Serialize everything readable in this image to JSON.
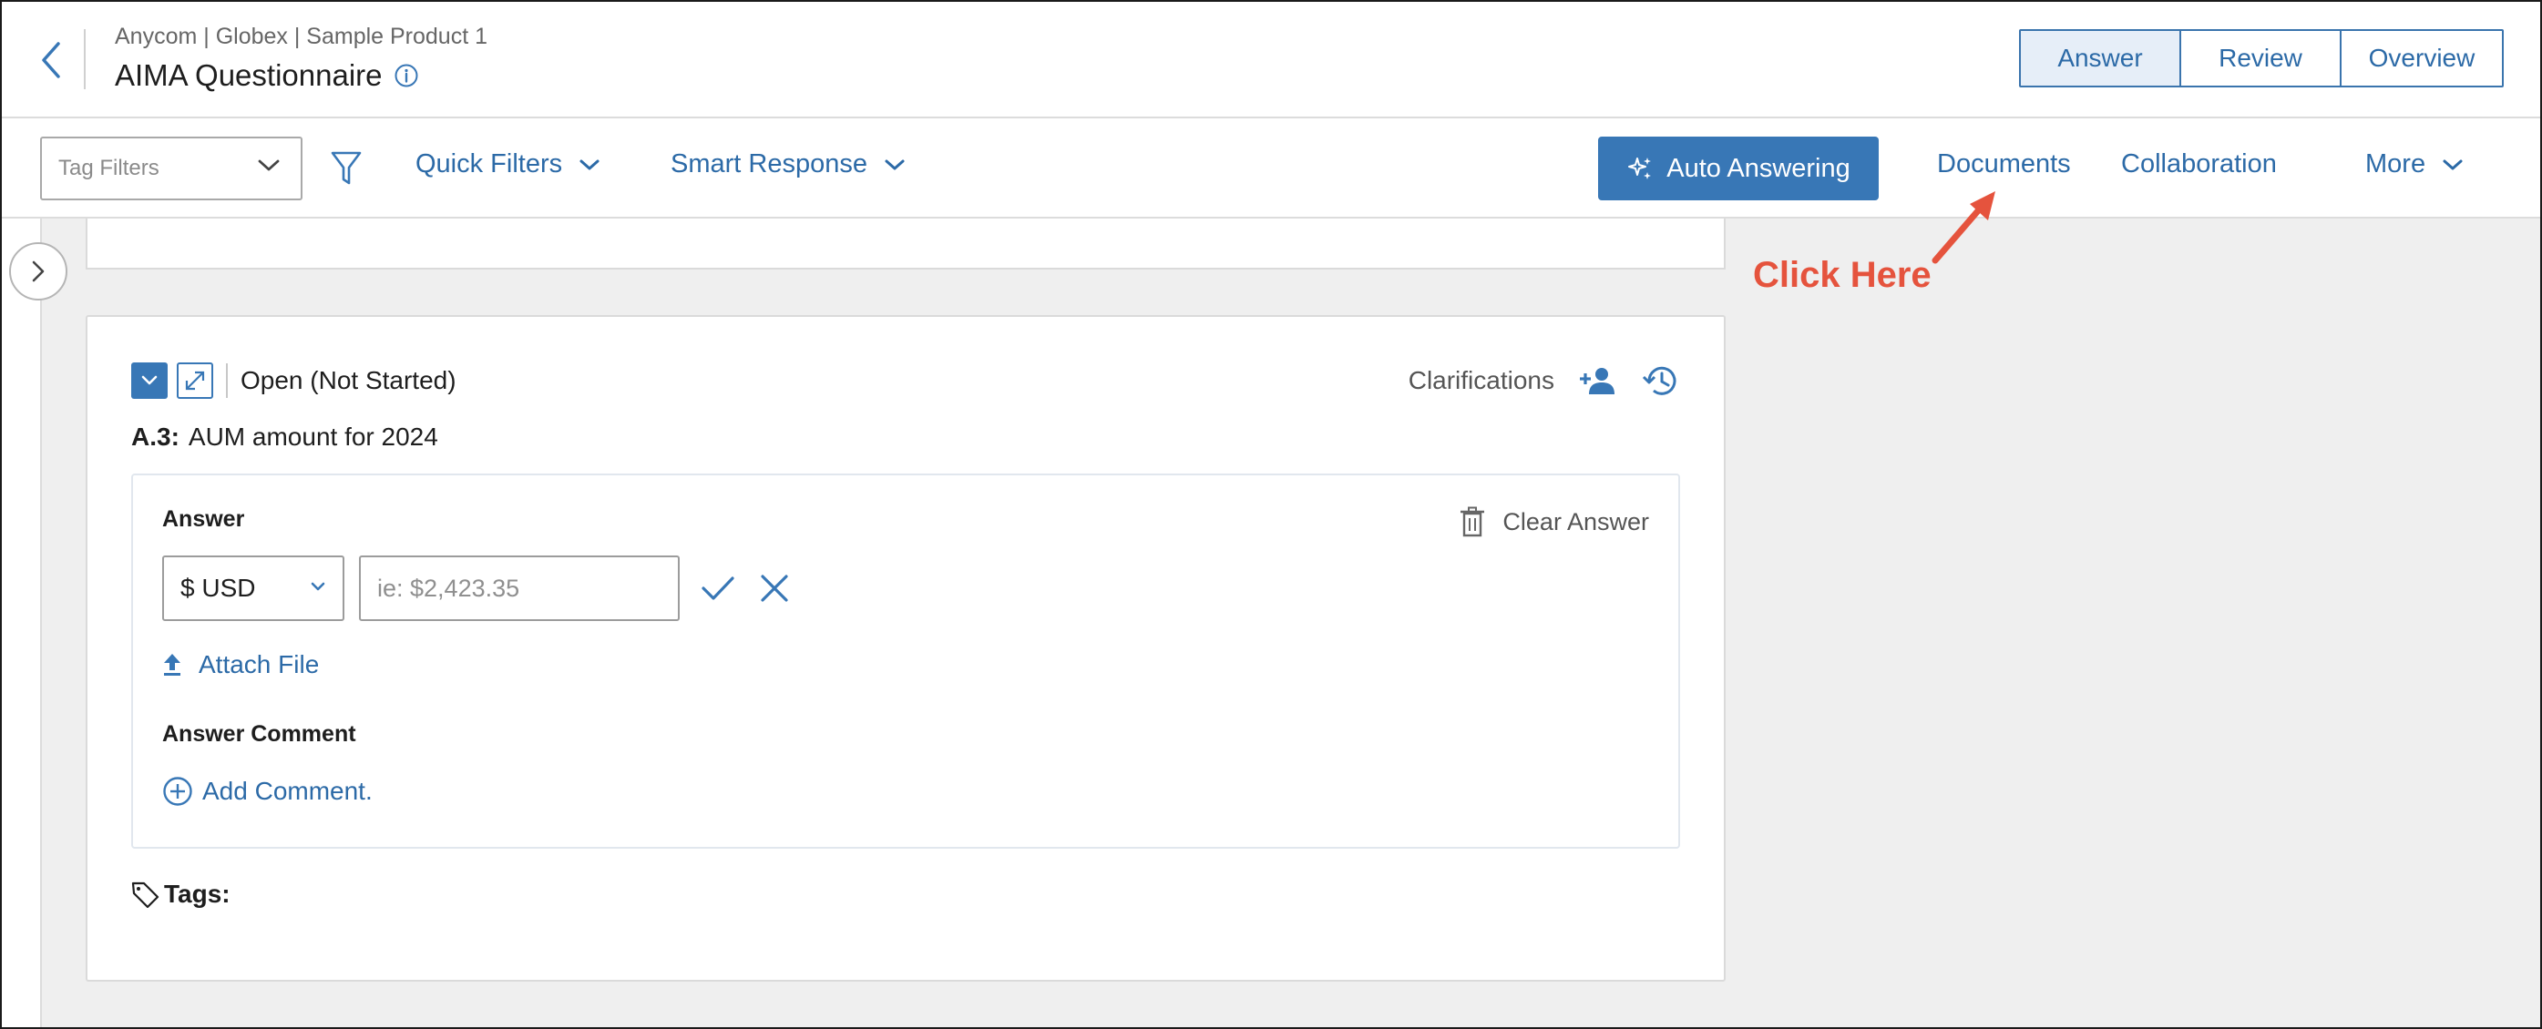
{
  "header": {
    "breadcrumb": "Anycom | Globex | Sample Product 1",
    "title": "AIMA Questionnaire",
    "tabs": [
      {
        "label": "Answer",
        "active": true
      },
      {
        "label": "Review",
        "active": false
      },
      {
        "label": "Overview",
        "active": false
      }
    ]
  },
  "toolbar": {
    "tag_filter_placeholder": "Tag Filters",
    "quick_filters": "Quick Filters",
    "smart_response": "Smart Response",
    "auto_answering": "Auto Answering",
    "documents": "Documents",
    "collaboration": "Collaboration",
    "more": "More"
  },
  "question": {
    "status": "Open (Not Started)",
    "clarifications": "Clarifications",
    "id": "A.3:",
    "text": "AUM amount for 2024",
    "answer_label": "Answer",
    "clear_answer": "Clear Answer",
    "currency": "$ USD",
    "amount_placeholder": "ie: $2,423.35",
    "amount_value": "",
    "attach_file": "Attach File",
    "comment_label": "Answer Comment",
    "add_comment": "Add Comment.",
    "tags_label": "Tags:"
  },
  "annotation": {
    "text": "Click Here",
    "color": "#e5533d"
  },
  "colors": {
    "primary": "#3877b6",
    "link": "#2c6aa7",
    "active_tab_bg": "#e6eef8"
  }
}
